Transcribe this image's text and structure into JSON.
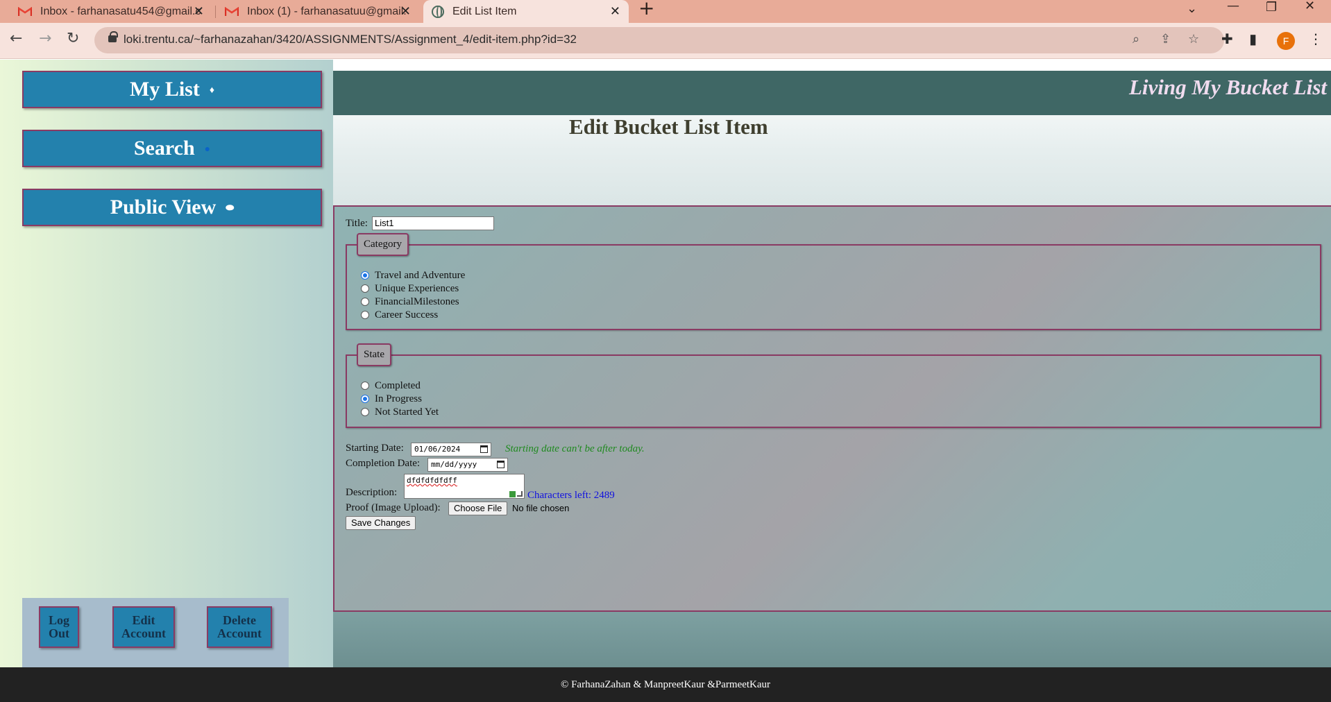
{
  "browser": {
    "tabs": [
      {
        "title": "Inbox - farhanasatu454@gmail.c",
        "icon": "gmail-icon",
        "active": false
      },
      {
        "title": "Inbox (1) - farhanasatuu@gmail.",
        "icon": "gmail-icon",
        "active": false
      },
      {
        "title": "Edit List Item",
        "icon": "globe-icon",
        "active": true
      }
    ],
    "url": "loki.trentu.ca/~farhanazahan/3420/ASSIGNMENTS/Assignment_4/edit-item.php?id=32",
    "profile_initial": "F",
    "colors": {
      "tabstrip": "#e8ab98",
      "toolbar": "#f7e3dd",
      "profile": "#e8710a"
    }
  },
  "sidebar": {
    "nav": [
      {
        "label": "My List",
        "icon": "diamond-icon"
      },
      {
        "label": "Search",
        "icon": "search-icon"
      },
      {
        "label": "Public View",
        "icon": "eye-icon"
      }
    ],
    "account": {
      "logout": [
        "Log",
        "Out"
      ],
      "edit": [
        "Edit",
        "Account"
      ],
      "delete": [
        "Delete",
        "Account"
      ]
    }
  },
  "header": {
    "site_title": "Living My Bucket List",
    "page_heading": "Edit Bucket List Item"
  },
  "form": {
    "title_label": "Title:",
    "title_value": "List1",
    "category": {
      "legend": "Category",
      "options": [
        "Travel and Adventure",
        "Unique Experiences",
        "FinancialMilestones",
        "Career Success"
      ],
      "selected": "Travel and Adventure"
    },
    "state": {
      "legend": "State",
      "options": [
        "Completed",
        "In Progress",
        "Not Started Yet"
      ],
      "selected": "In Progress"
    },
    "start_label": "Starting Date:",
    "start_value": "01/06/2024",
    "start_hint": "Starting date can't be after today.",
    "completion_label": "Completion Date:",
    "completion_placeholder": "mm/dd/yyyy",
    "description_label": "Description:",
    "description_value": "dfdfdfdfdff",
    "chars_left": "Characters left: 2489",
    "proof_label": "Proof (Image Upload):",
    "choose_file": "Choose File",
    "file_status": "No file chosen",
    "save_label": "Save Changes"
  },
  "footer": {
    "text": "© FarhanaZahan & ManpreetKaur &ParmeetKaur"
  },
  "theme": {
    "nav_button": "#2381ad",
    "border_accent": "#8a3a63",
    "banner": "#3f6765",
    "hint": "#1f8a1f",
    "counter": "#1010e0",
    "footer": "#222222"
  }
}
